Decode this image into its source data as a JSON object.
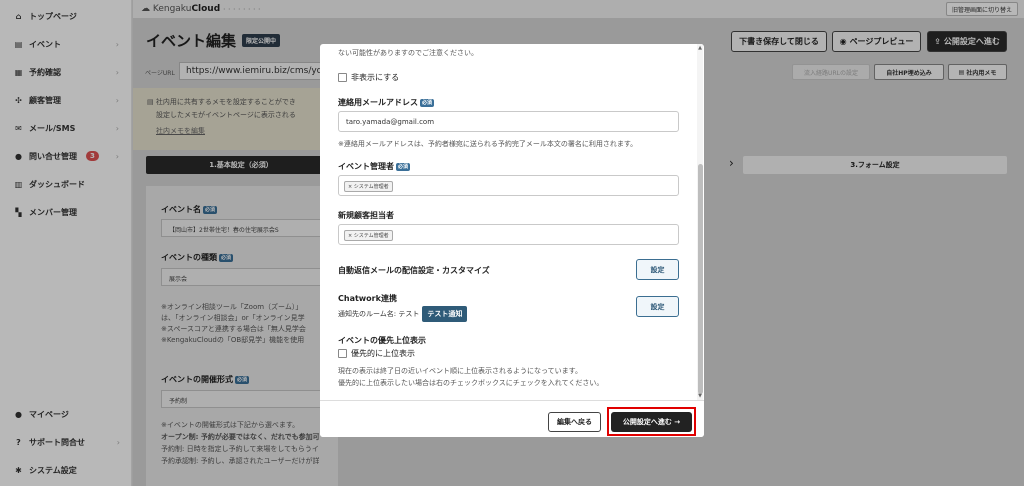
{
  "sidebar": {
    "items": [
      {
        "label": "トップページ",
        "icon": "home-icon",
        "glyph": "⌂",
        "chevron": false
      },
      {
        "label": "イベント",
        "icon": "document-icon",
        "glyph": "▤",
        "chevron": true
      },
      {
        "label": "予約確認",
        "icon": "calendar-icon",
        "glyph": "▦",
        "chevron": true
      },
      {
        "label": "顧客管理",
        "icon": "users-icon",
        "glyph": "✣",
        "chevron": true
      },
      {
        "label": "メール/SMS",
        "icon": "mail-icon",
        "glyph": "✉",
        "chevron": true
      },
      {
        "label": "問い合せ管理",
        "icon": "chat-icon",
        "glyph": "●",
        "chevron": true,
        "badge": "3"
      },
      {
        "label": "ダッシュボード",
        "icon": "chart-icon",
        "glyph": "▥",
        "chevron": false
      },
      {
        "label": "メンバー管理",
        "icon": "grid-icon",
        "glyph": "▚",
        "chevron": false
      }
    ],
    "bottom_items": [
      {
        "label": "マイページ",
        "icon": "person-icon",
        "glyph": "●",
        "chevron": false
      },
      {
        "label": "サポート問合せ",
        "icon": "help-icon",
        "glyph": "?",
        "chevron": true
      },
      {
        "label": "システム設定",
        "icon": "gear-icon",
        "glyph": "✱",
        "chevron": false
      }
    ]
  },
  "topbar": {
    "logo_prefix": "Kengaku",
    "logo_bold": "Cloud",
    "logo_suffix": " ・・・・・・・・",
    "switch_label": "旧管理画面に切り替え"
  },
  "header": {
    "title": "イベント編集",
    "tag": "限定公開中",
    "draft_button": "下書き保存して閉じる",
    "preview_button": "ページプレビュー",
    "publish_button": "公開設定へ進む"
  },
  "url_bar": {
    "label": "ページURL",
    "value": "https://www.iemiru.biz/cms/yo",
    "entry_button": "流入経路URLの設定",
    "embed_button": "自社HP埋め込み",
    "memo_button": "社内用メモ"
  },
  "memo": {
    "line1": "社内用に共有するメモを設定することができ",
    "line2": "設定したメモがイベントページに表示される",
    "link": "社内メモを編集"
  },
  "steps": {
    "step1": "1.基本設定（必須）",
    "step3": "3.フォーム設定"
  },
  "form": {
    "event_name_label": "イベント名",
    "event_name_value": "【岡山市】2世帯住宅！春の住宅展示会S",
    "event_type_label": "イベントの種類",
    "event_type_value": "展示会",
    "type_note": [
      "※オンライン相談ツール「Zoom（ズーム）」",
      "は、「オンライン相談会」or「オンライン見学",
      "※スペースコアと連携する場合は「無人見学会",
      "※KengakuCloudの「OB邸見学」機能を使用"
    ],
    "format_label": "イベントの開催形式",
    "format_value": "予約制",
    "format_note": [
      "※イベントの開催形式は下記から選べます。",
      "オープン制: 予約が必要ではなく、だれでも参加可能なイベント",
      "予約制: 日時を指定し予約して来場をしてもらうイベント",
      "予約承認制: 予約し、承認されたユーザーだけが詳細閲覧可能にするイベント"
    ],
    "required_tag": "必須"
  },
  "modal": {
    "top_note": "ない可能性がありますのでご注意ください。",
    "hide_label": "非表示にする",
    "contact_email_label": "連絡用メールアドレス",
    "contact_email_value": "taro.yamada@gmail.com",
    "contact_email_note": "※連絡用メールアドレスは、予約者様宛に送られる予約完了メール本文の署名に利用されます。",
    "manager_label": "イベント管理者",
    "manager_chip": "× システム管理者",
    "new_customer_label": "新規顧客担当者",
    "new_customer_chip": "× システム管理者",
    "auto_reply_label": "自動返信メールの配信設定・カスタマイズ",
    "setting_button": "設定",
    "chatwork_label": "Chatwork連携",
    "chatwork_room": "通知先のルーム名: テスト",
    "test_button": "テスト通知",
    "priority_label": "イベントの優先上位表示",
    "priority_checkbox": "優先的に上位表示",
    "priority_note1": "現在の表示は終了日の近いイベント順に上位表示されるようになっています。",
    "priority_note2": "優先的に上位表示したい場合は右のチェックボックスにチェックを入れてください。",
    "required_tag": "必須",
    "back_button": "編集へ戻る",
    "next_button": "公開設定へ進む →"
  }
}
